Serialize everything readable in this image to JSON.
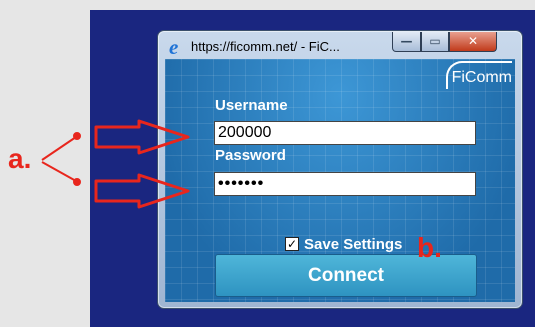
{
  "window": {
    "title": "https://ficomm.net/ - FiC...",
    "controls": {
      "minimize": "—",
      "maximize": "▭",
      "close": "✕"
    }
  },
  "brand": {
    "logo_text": "FiComm"
  },
  "login": {
    "username_label": "Username",
    "username_value": "200000",
    "password_label": "Password",
    "password_value": "•••••••",
    "save_settings_label": "Save Settings",
    "save_settings_checked": true,
    "checkbox_mark": "✓",
    "connect_label": "Connect"
  },
  "annotations": {
    "a": "a.",
    "b": "b."
  },
  "colors": {
    "annotation": "#e8261d",
    "desktop": "#1a2680",
    "panel": "#2a78b8",
    "button": "#3aa6d0"
  }
}
